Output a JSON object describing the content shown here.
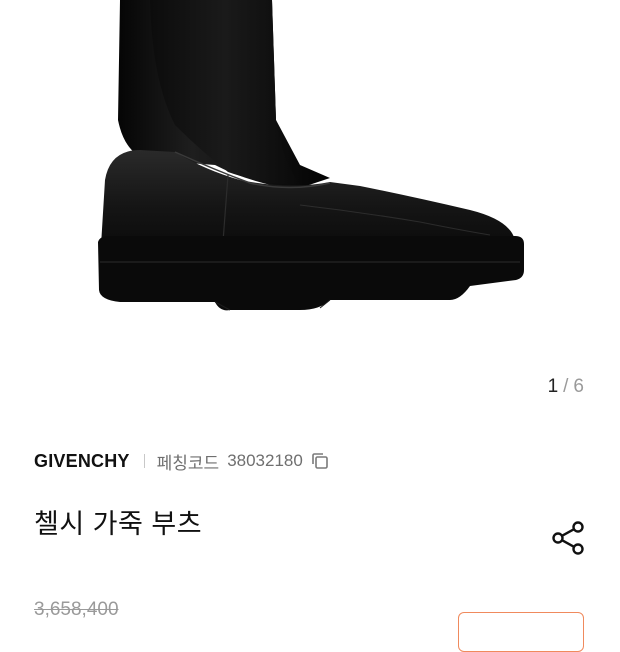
{
  "gallery": {
    "image": "black-leather-chelsea-boot",
    "current": "1",
    "separator": "/",
    "total": "6"
  },
  "product": {
    "brand": "GIVENCHY",
    "code_label": "페칭코드",
    "code_value": "38032180",
    "title": "첼시 가죽 부츠",
    "original_price": "3,658,400"
  },
  "icons": {
    "copy": "copy-icon",
    "share": "share-icon"
  },
  "colors": {
    "accent": "#f08a5d",
    "muted": "#9a9a9a"
  }
}
